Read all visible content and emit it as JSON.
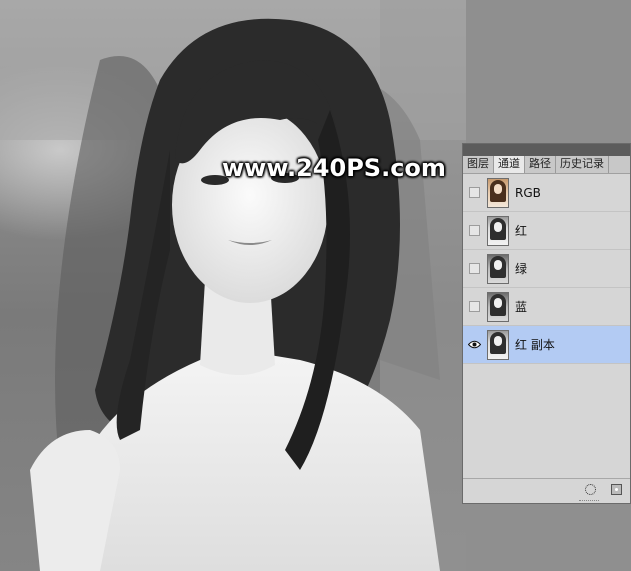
{
  "watermark": "www.240PS.com",
  "panel": {
    "tabs": [
      {
        "label": "图层",
        "active": false
      },
      {
        "label": "通道",
        "active": true
      },
      {
        "label": "路径",
        "active": false
      },
      {
        "label": "历史记录",
        "active": false
      }
    ],
    "channels": [
      {
        "label": "RGB",
        "visible": false,
        "selected": false
      },
      {
        "label": "红",
        "visible": false,
        "selected": false
      },
      {
        "label": "绿",
        "visible": false,
        "selected": false
      },
      {
        "label": "蓝",
        "visible": false,
        "selected": false
      },
      {
        "label": "红 副本",
        "visible": true,
        "selected": true
      }
    ],
    "footer_icons": [
      "load-channel-as-selection-icon",
      "save-selection-as-channel-icon"
    ]
  },
  "colors": {
    "selected_row": "#b3cbf3",
    "panel_bg": "#d6d6d6",
    "work_area": "#8f8f8f"
  }
}
